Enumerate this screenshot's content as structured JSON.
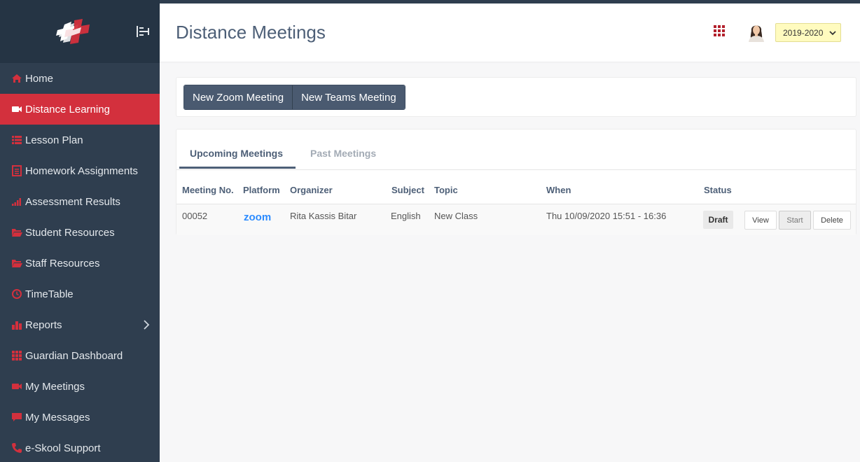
{
  "header": {
    "title": "Distance Meetings",
    "year_selected": "2019-2020"
  },
  "sidebar": {
    "items": [
      {
        "label": "Home",
        "icon": "home-icon"
      },
      {
        "label": "Distance Learning",
        "icon": "video-camera-icon",
        "active": true
      },
      {
        "label": "Lesson Plan",
        "icon": "list-icon"
      },
      {
        "label": "Homework Assignments",
        "icon": "document-list-icon"
      },
      {
        "label": "Assessment Results",
        "icon": "signal-bars-icon"
      },
      {
        "label": "Student Resources",
        "icon": "folder-open-icon"
      },
      {
        "label": "Staff Resources",
        "icon": "folder-open-icon"
      },
      {
        "label": "TimeTable",
        "icon": "clock-icon"
      },
      {
        "label": "Reports",
        "icon": "bar-chart-icon",
        "has_submenu": true
      },
      {
        "label": "Guardian Dashboard",
        "icon": "grid-icon"
      },
      {
        "label": "My Meetings",
        "icon": "video-camera-icon"
      },
      {
        "label": "My Messages",
        "icon": "chat-bubble-icon"
      },
      {
        "label": "e-Skool Support",
        "icon": "phone-icon"
      }
    ]
  },
  "actions": {
    "new_zoom": "New Zoom Meeting",
    "new_teams": "New Teams Meeting"
  },
  "tabs": {
    "upcoming": "Upcoming Meetings",
    "past": "Past Meetings"
  },
  "table": {
    "columns": {
      "meeting_no": "Meeting No.",
      "platform": "Platform",
      "organizer": "Organizer",
      "subject": "Subject",
      "topic": "Topic",
      "when": "When",
      "status": "Status"
    },
    "rows": [
      {
        "meeting_no": "00052",
        "platform": "zoom",
        "organizer": "Rita Kassis Bitar",
        "subject": "English",
        "topic": "New Class",
        "when": "Thu 10/09/2020 15:51 - 16:36",
        "status": "Draft",
        "view_label": "View",
        "start_label": "Start",
        "delete_label": "Delete"
      }
    ]
  },
  "colors": {
    "sidebar_bg": "#2f3e4f",
    "accent_red": "#d3303d",
    "title_color": "#4d5f77",
    "zoom_blue": "#2d8cff",
    "year_select_bg": "#fffbbf"
  }
}
